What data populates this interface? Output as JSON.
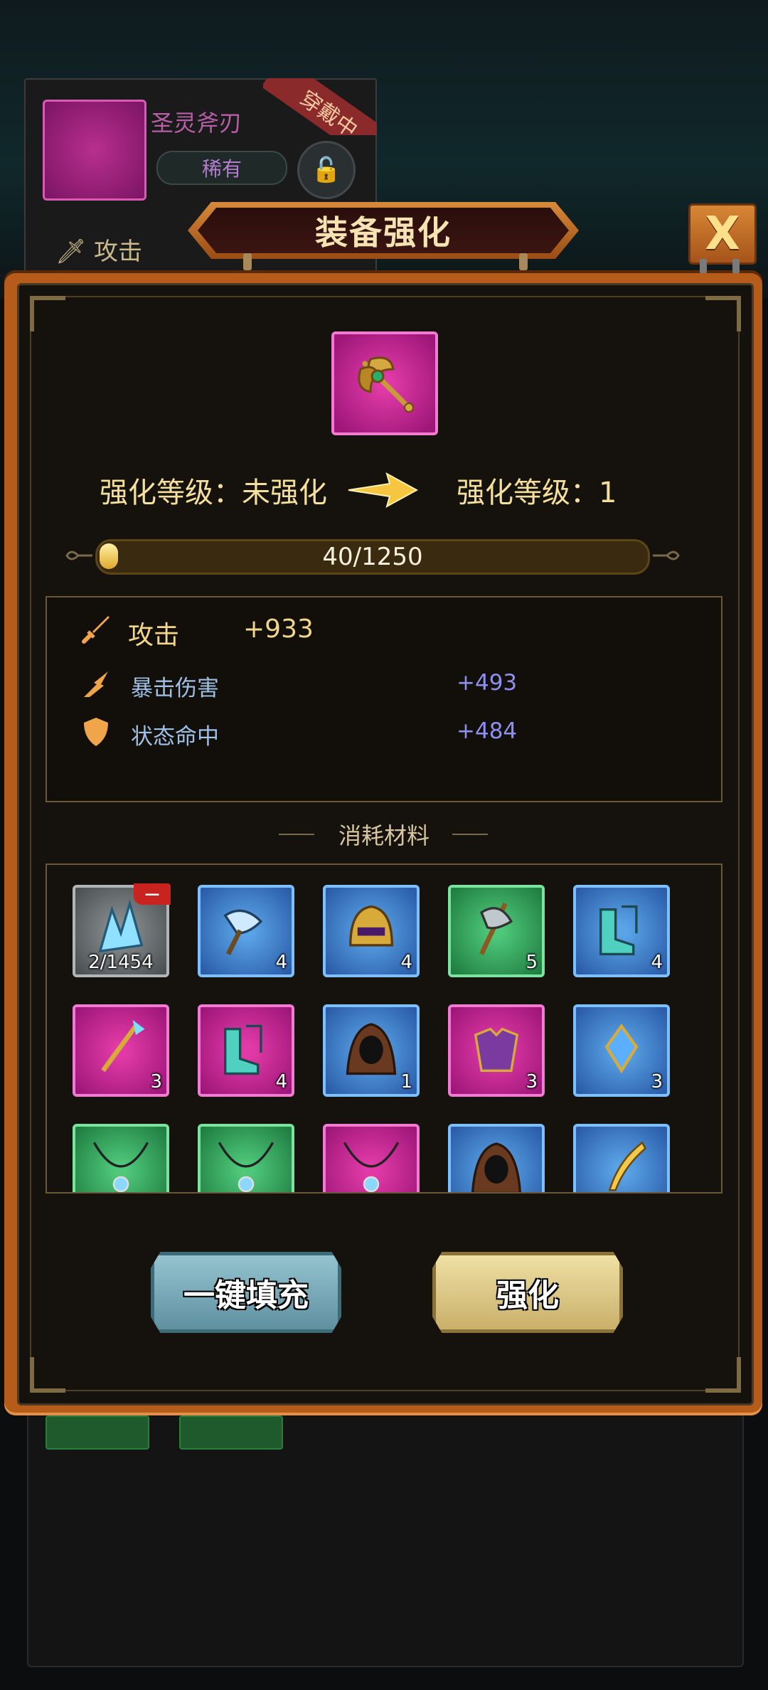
{
  "background": {
    "item_name": "圣灵斧刃",
    "rarity": "稀有",
    "wearing_badge": "穿戴中",
    "attack_label": "攻击"
  },
  "dialog": {
    "title": "装备强化",
    "close_label": "X"
  },
  "level": {
    "current_label": "强化等级：未强化",
    "next_label": "强化等级：1"
  },
  "progress": {
    "text": "40/1250",
    "fraction": 0.032
  },
  "stats": {
    "main": {
      "label": "攻击",
      "value": "+933"
    },
    "sub": [
      {
        "label": "暴击伤害",
        "value": "+493"
      },
      {
        "label": "状态命中",
        "value": "+484"
      }
    ]
  },
  "materials": {
    "title": "消耗材料",
    "items": [
      {
        "rarity": "gray",
        "icon": "crystal-icon",
        "count": "2/1454"
      },
      {
        "rarity": "blue",
        "icon": "axe-icon",
        "count": "4"
      },
      {
        "rarity": "blue",
        "icon": "helmet-icon",
        "count": "4"
      },
      {
        "rarity": "green",
        "icon": "battle-axe-icon",
        "count": "5"
      },
      {
        "rarity": "blue",
        "icon": "boots-icon",
        "count": "4"
      },
      {
        "rarity": "pink",
        "icon": "scepter-icon",
        "count": "3"
      },
      {
        "rarity": "pink",
        "icon": "boots-icon",
        "count": "4"
      },
      {
        "rarity": "blue",
        "icon": "hood-icon",
        "count": "1"
      },
      {
        "rarity": "pink",
        "icon": "armor-icon",
        "count": "3"
      },
      {
        "rarity": "blue",
        "icon": "amulet-icon",
        "count": "3"
      },
      {
        "rarity": "green",
        "icon": "necklace-icon",
        "count": ""
      },
      {
        "rarity": "green",
        "icon": "necklace-icon",
        "count": ""
      },
      {
        "rarity": "pink",
        "icon": "necklace-icon",
        "count": ""
      },
      {
        "rarity": "blue",
        "icon": "hood-icon",
        "count": ""
      },
      {
        "rarity": "blue",
        "icon": "blade-icon",
        "count": ""
      }
    ]
  },
  "buttons": {
    "auto_fill": "一键填充",
    "enhance": "强化"
  }
}
